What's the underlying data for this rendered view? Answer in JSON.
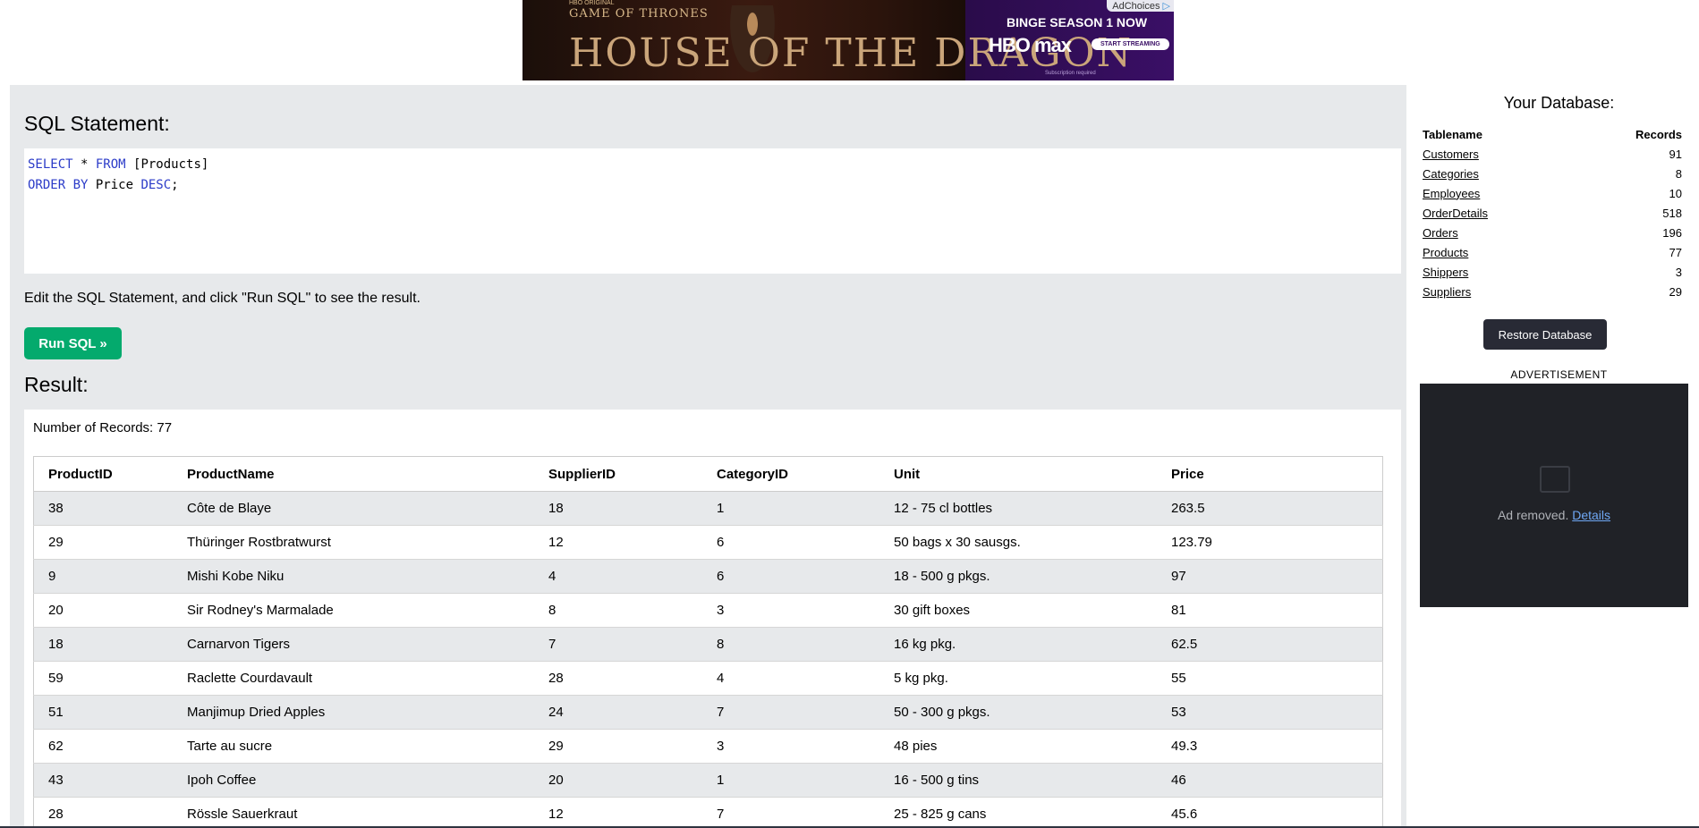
{
  "top_ad": {
    "hbo_original": "HBO ORIGINAL",
    "show_sub": "GAME OF THRONES",
    "show_title": "HOUSE OF THE DRAGON",
    "binge": "BINGE SEASON 1 NOW",
    "brand": "HBO max",
    "cta": "START STREAMING",
    "fine_print": "Subscription required",
    "adchoices": "AdChoices"
  },
  "editor": {
    "heading": "SQL Statement:",
    "line1_kw1": "SELECT",
    "line1_mid": " * ",
    "line1_kw2": "FROM",
    "line1_rest": " [Products]",
    "line2_kw1": "ORDER BY",
    "line2_mid": " Price ",
    "line2_kw2": "DESC",
    "line2_rest": ";",
    "hint": "Edit the SQL Statement, and click \"Run SQL\" to see the result.",
    "run_label": "Run SQL »"
  },
  "result": {
    "heading": "Result:",
    "count_text": "Number of Records: 77",
    "columns": [
      "ProductID",
      "ProductName",
      "SupplierID",
      "CategoryID",
      "Unit",
      "Price"
    ],
    "rows": [
      [
        "38",
        "Côte de Blaye",
        "18",
        "1",
        "12 - 75 cl bottles",
        "263.5"
      ],
      [
        "29",
        "Thüringer Rostbratwurst",
        "12",
        "6",
        "50 bags x 30 sausgs.",
        "123.79"
      ],
      [
        "9",
        "Mishi Kobe Niku",
        "4",
        "6",
        "18 - 500 g pkgs.",
        "97"
      ],
      [
        "20",
        "Sir Rodney's Marmalade",
        "8",
        "3",
        "30 gift boxes",
        "81"
      ],
      [
        "18",
        "Carnarvon Tigers",
        "7",
        "8",
        "16 kg pkg.",
        "62.5"
      ],
      [
        "59",
        "Raclette Courdavault",
        "28",
        "4",
        "5 kg pkg.",
        "55"
      ],
      [
        "51",
        "Manjimup Dried Apples",
        "24",
        "7",
        "50 - 300 g pkgs.",
        "53"
      ],
      [
        "62",
        "Tarte au sucre",
        "29",
        "3",
        "48 pies",
        "49.3"
      ],
      [
        "43",
        "Ipoh Coffee",
        "20",
        "1",
        "16 - 500 g tins",
        "46"
      ],
      [
        "28",
        "Rössle Sauerkraut",
        "12",
        "7",
        "25 - 825 g cans",
        "45.6"
      ]
    ]
  },
  "database": {
    "title": "Your Database:",
    "col_table": "Tablename",
    "col_records": "Records",
    "tables": [
      {
        "name": "Customers",
        "records": "91"
      },
      {
        "name": "Categories",
        "records": "8"
      },
      {
        "name": "Employees",
        "records": "10"
      },
      {
        "name": "OrderDetails",
        "records": "518"
      },
      {
        "name": "Orders",
        "records": "196"
      },
      {
        "name": "Products",
        "records": "77"
      },
      {
        "name": "Shippers",
        "records": "3"
      },
      {
        "name": "Suppliers",
        "records": "29"
      }
    ],
    "restore_label": "Restore Database"
  },
  "side_ad": {
    "label": "ADVERTISEMENT",
    "removed_text": "Ad removed.",
    "details_link": "Details"
  },
  "colors": {
    "run_button": "#04aa6d",
    "restore_button": "#282a35",
    "panel_bg": "#e7e9eb",
    "sql_keyword": "#2b3bc8"
  }
}
